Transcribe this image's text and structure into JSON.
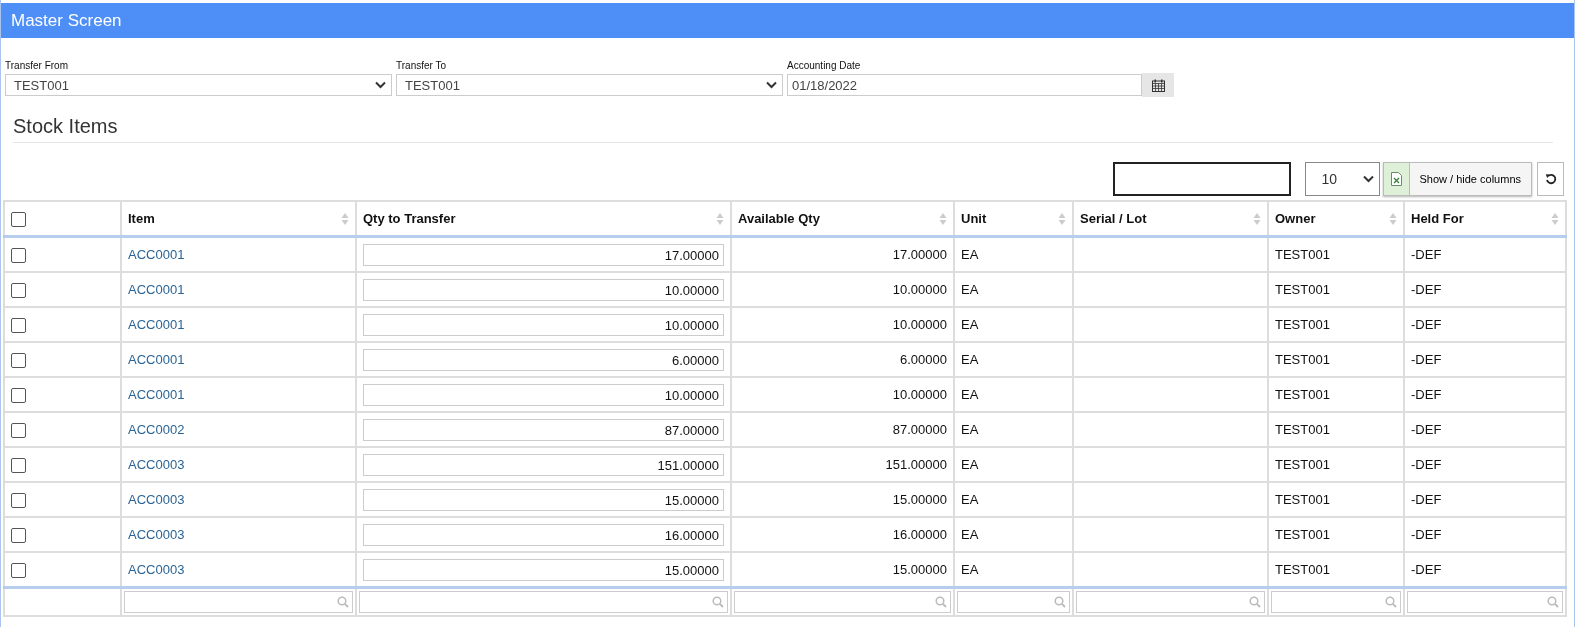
{
  "window": {
    "title": "Master Screen"
  },
  "fields": [
    {
      "kind": "select",
      "label": "Transfer From",
      "value": "TEST001"
    },
    {
      "kind": "select",
      "label": "Transfer To",
      "value": "TEST001"
    },
    {
      "kind": "date",
      "label": "Accounting Date",
      "value": "01/18/2022"
    }
  ],
  "section_title": "Stock Items",
  "toolbar": {
    "page_size": "10",
    "columns_button": "Show / hide columns"
  },
  "table": {
    "select_all_checked": false,
    "columns": [
      {
        "label": "Item"
      },
      {
        "label": "Qty to Transfer"
      },
      {
        "label": "Available Qty"
      },
      {
        "label": "Unit"
      },
      {
        "label": "Serial / Lot"
      },
      {
        "label": "Owner"
      },
      {
        "label": "Held For"
      }
    ],
    "rows": [
      {
        "checked": false,
        "item": "ACC0001",
        "qty": "17.00000",
        "available": "17.00000",
        "unit": "EA",
        "owner": "TEST001",
        "held_for": "-DEF"
      },
      {
        "checked": false,
        "item": "ACC0001",
        "qty": "10.00000",
        "available": "10.00000",
        "unit": "EA",
        "owner": "TEST001",
        "held_for": "-DEF"
      },
      {
        "checked": false,
        "item": "ACC0001",
        "qty": "10.00000",
        "available": "10.00000",
        "unit": "EA",
        "owner": "TEST001",
        "held_for": "-DEF"
      },
      {
        "checked": false,
        "item": "ACC0001",
        "qty": "6.00000",
        "available": "6.00000",
        "unit": "EA",
        "owner": "TEST001",
        "held_for": "-DEF"
      },
      {
        "checked": false,
        "item": "ACC0001",
        "qty": "10.00000",
        "available": "10.00000",
        "unit": "EA",
        "owner": "TEST001",
        "held_for": "-DEF"
      },
      {
        "checked": false,
        "item": "ACC0002",
        "qty": "87.00000",
        "available": "87.00000",
        "unit": "EA",
        "owner": "TEST001",
        "held_for": "-DEF"
      },
      {
        "checked": false,
        "item": "ACC0003",
        "qty": "151.00000",
        "available": "151.00000",
        "unit": "EA",
        "owner": "TEST001",
        "held_for": "-DEF"
      },
      {
        "checked": false,
        "item": "ACC0003",
        "qty": "15.00000",
        "available": "15.00000",
        "unit": "EA",
        "owner": "TEST001",
        "held_for": "-DEF"
      },
      {
        "checked": false,
        "item": "ACC0003",
        "qty": "16.00000",
        "available": "16.00000",
        "unit": "EA",
        "owner": "TEST001",
        "held_for": "-DEF"
      },
      {
        "checked": false,
        "item": "ACC0003",
        "qty": "15.00000",
        "available": "15.00000",
        "unit": "EA",
        "owner": "TEST001",
        "held_for": "-DEF"
      }
    ]
  }
}
